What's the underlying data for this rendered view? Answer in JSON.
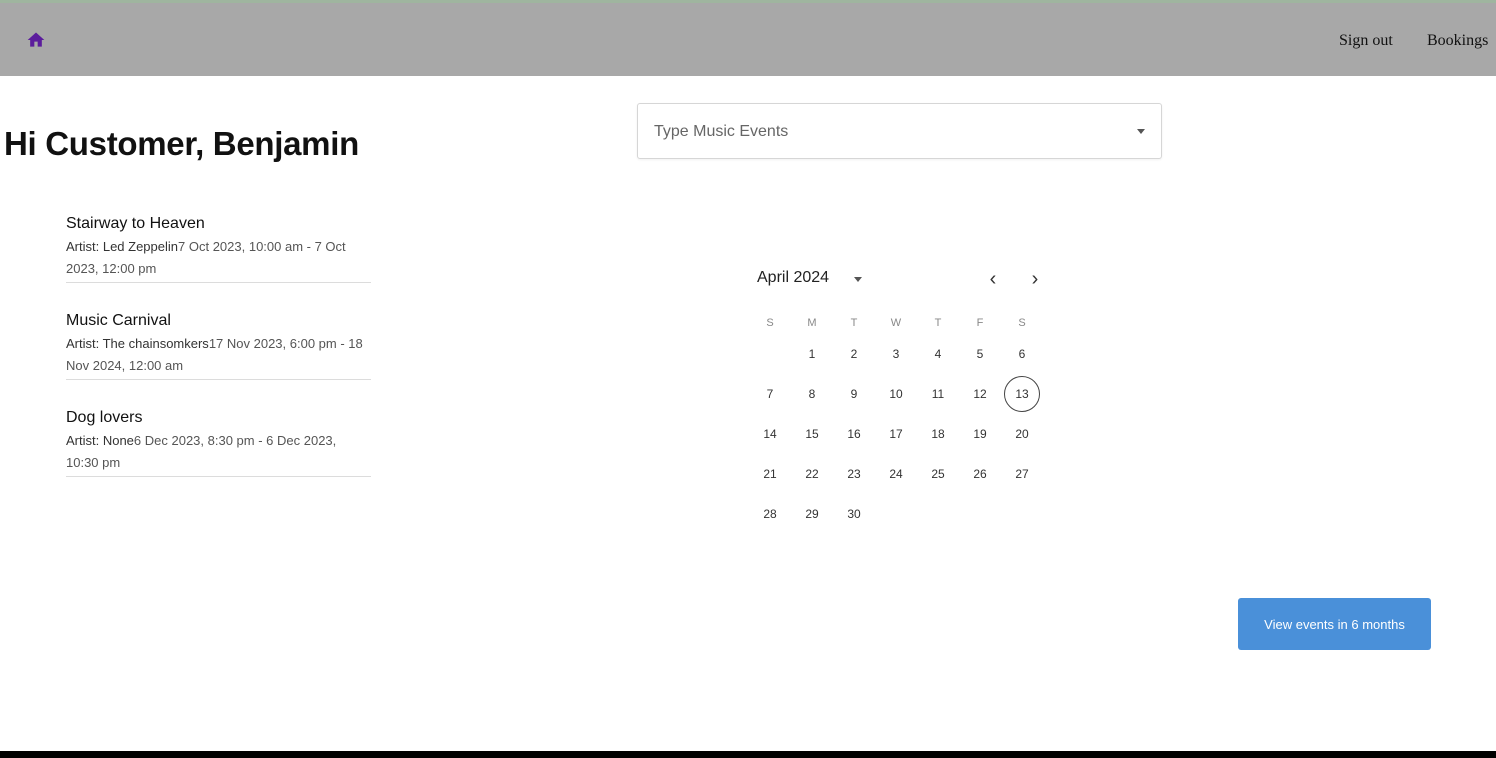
{
  "nav": {
    "home_icon": "home-icon",
    "icon_color": "#5b1c9c",
    "links": [
      "Sign out",
      "Bookings"
    ]
  },
  "greeting": "Hi Customer, Benjamin",
  "events": [
    {
      "title": "Stairway to Heaven",
      "artist": "Artist: Led Zeppelin",
      "time": "7 Oct 2023, 10:00 am - 7 Oct 2023, 12:00 pm"
    },
    {
      "title": "Music Carnival",
      "artist": "Artist: The chainsomkers",
      "time": "17 Nov 2023, 6:00 pm - 18 Nov 2024, 12:00 am"
    },
    {
      "title": "Dog lovers",
      "artist": "Artist: None",
      "time": "6 Dec 2023, 8:30 pm - 6 Dec 2023, 10:30 pm"
    }
  ],
  "search": {
    "placeholder": "Type Music Events",
    "value": ""
  },
  "calendar": {
    "month_label": "April 2024",
    "prev_icon": "chevron-left-icon",
    "next_icon": "chevron-right-icon",
    "weekdays": [
      "S",
      "M",
      "T",
      "W",
      "T",
      "F",
      "S"
    ],
    "weeks": [
      [
        "",
        "1",
        "2",
        "3",
        "4",
        "5",
        "6"
      ],
      [
        "7",
        "8",
        "9",
        "10",
        "11",
        "12",
        "13"
      ],
      [
        "14",
        "15",
        "16",
        "17",
        "18",
        "19",
        "20"
      ],
      [
        "21",
        "22",
        "23",
        "24",
        "25",
        "26",
        "27"
      ],
      [
        "28",
        "29",
        "30",
        "",
        "",
        "",
        ""
      ]
    ],
    "today": "13"
  },
  "view_button": {
    "label": "View events in 6 months",
    "color": "#4a90d9"
  }
}
